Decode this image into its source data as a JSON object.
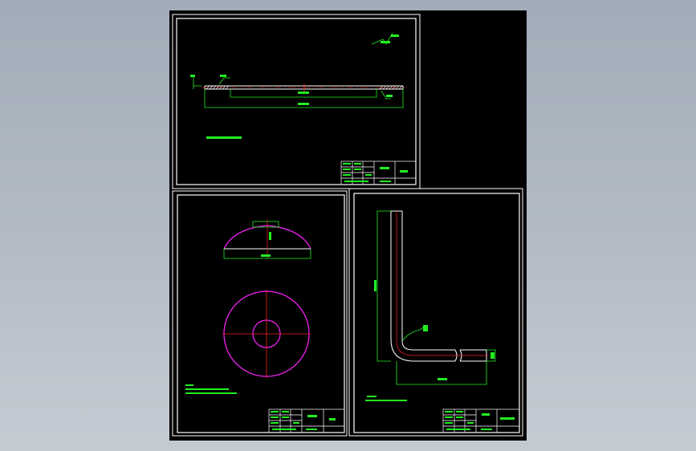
{
  "colors": {
    "background": "#000000",
    "frame": "#ffffff",
    "dimension": "#22ee22",
    "part": "#ffffff",
    "centerline": "#ff2020",
    "dome": "#ff22ff",
    "app_background": "#a8b2bd"
  },
  "sheet1": {
    "roughness_note": "6.3",
    "title_block": {
      "label_1": "",
      "label_2": ""
    }
  },
  "sheet2": {
    "title_block": {
      "label_1": "",
      "label_2": ""
    }
  },
  "sheet3": {
    "title_block": {
      "label_1": "",
      "label_2": ""
    }
  }
}
